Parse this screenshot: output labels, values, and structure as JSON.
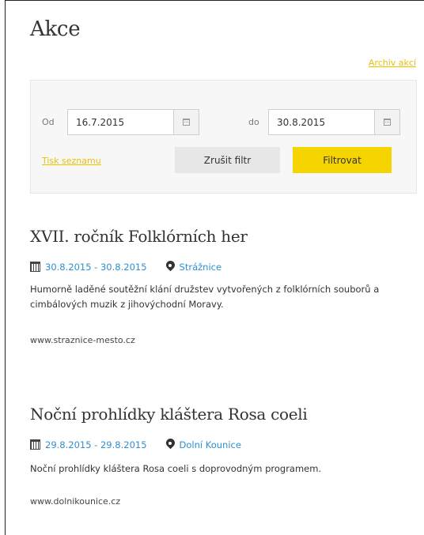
{
  "page": {
    "title": "Akce",
    "archive_link": "Archiv akcí"
  },
  "filter": {
    "from_label": "Od",
    "from_value": "16.7.2015",
    "to_label": "do",
    "to_value": "30.8.2015",
    "print_link": "Tisk seznamu",
    "reset_button": "Zrušit filtr",
    "filter_button": "Filtrovat",
    "accent_color": "#f5d400",
    "link_color": "#e8c200"
  },
  "events": [
    {
      "title": "XVII. ročník Folklórních her",
      "date": "30.8.2015 - 30.8.2015",
      "place": "Strážnice",
      "description": "Humorně laděné soutěžní klání družstev vytvořených z folklórních souborů a cimbálových muzik z jihovýchodní Moravy.",
      "url": "www.straznice-mesto.cz"
    },
    {
      "title": "Noční prohlídky kláštera Rosa coeli",
      "date": "29.8.2015 - 29.8.2015",
      "place": "Dolní Kounice",
      "description": "Noční prohlídky kláštera Rosa coeli s doprovodným programem.",
      "url": "www.dolnikounice.cz"
    }
  ],
  "icons": {
    "date": "calendar-icon",
    "place": "map-pin-icon",
    "picker": "calendar-picker-icon"
  }
}
